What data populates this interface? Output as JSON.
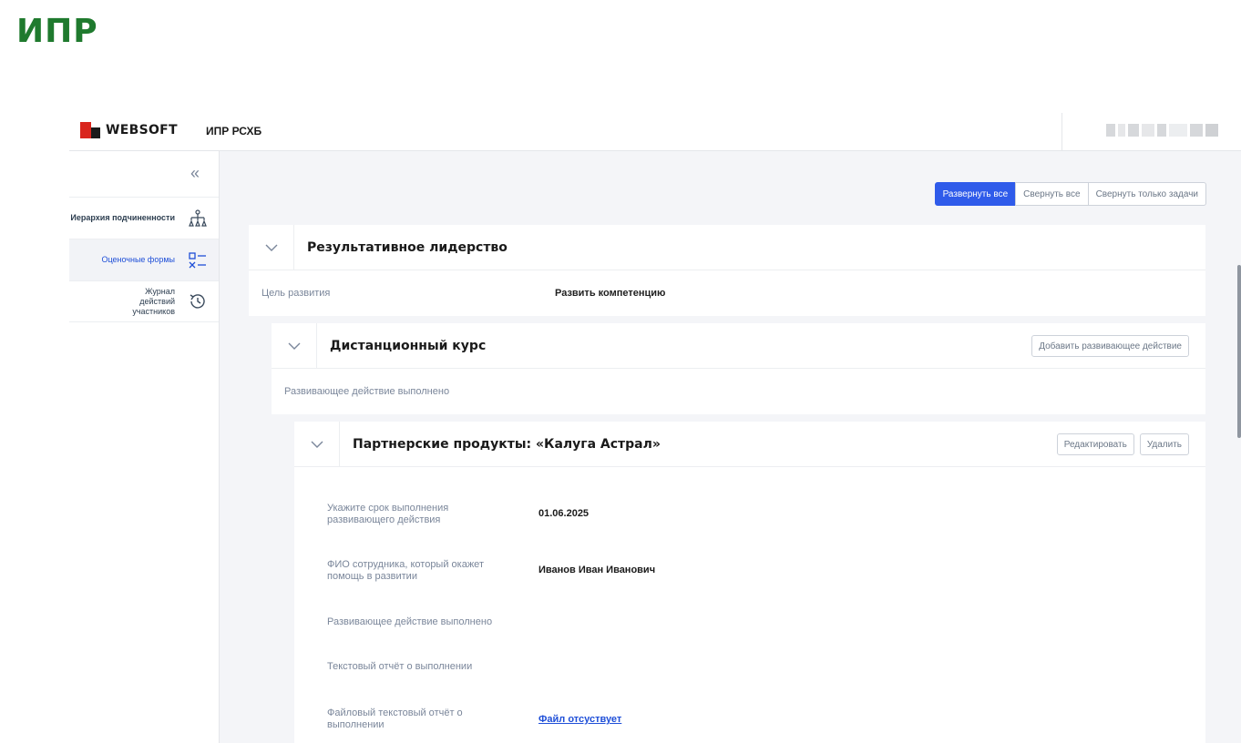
{
  "page_title": "ИПР",
  "topbar": {
    "logo_text": "WEBSOFT",
    "app_name": "ИПР РСХБ"
  },
  "sidebar": {
    "collapse_icon": "double-chevron-left-icon",
    "items": [
      {
        "label": "Иерархия подчиненности",
        "icon": "hierarchy-icon",
        "active": false
      },
      {
        "label": "Оценочные формы",
        "icon": "checklist-icon",
        "active": true
      },
      {
        "label": "Журнал действий участников",
        "icon": "history-icon",
        "active": false
      }
    ]
  },
  "toolbar": {
    "expand_all": "Развернуть все",
    "collapse_all": "Свернуть все",
    "collapse_tasks": "Свернуть только задачи"
  },
  "section1": {
    "title": "Результативное лидерство",
    "goal_label": "Цель развития",
    "goal_value": "Развить компетенцию"
  },
  "section2": {
    "title": "Дистанционный курс",
    "add_button": "Добавить развивающее действие",
    "status_text": "Развивающее действие выполнено"
  },
  "section3": {
    "title": "Партнерские продукты: «Калуга Астрал»",
    "edit_button": "Редактировать",
    "delete_button": "Удалить",
    "fields": [
      {
        "label": "Укажите срок выполнения развивающего действия",
        "value": "01.06.2025"
      },
      {
        "label": "ФИО сотрудника, который окажет помощь в развитии",
        "value": "Иванов Иван Иванович"
      },
      {
        "label": "Развивающее действие выполнено",
        "value": ""
      },
      {
        "label": "Текстовый отчёт о выполнении",
        "value": ""
      },
      {
        "label": "Файловый текстовый отчёт о выполнении",
        "value": "Файл отсуствует"
      }
    ]
  },
  "colors": {
    "brand_green": "#1f7a2e",
    "primary_blue": "#2f5bea",
    "logo_red": "#d9251d"
  }
}
